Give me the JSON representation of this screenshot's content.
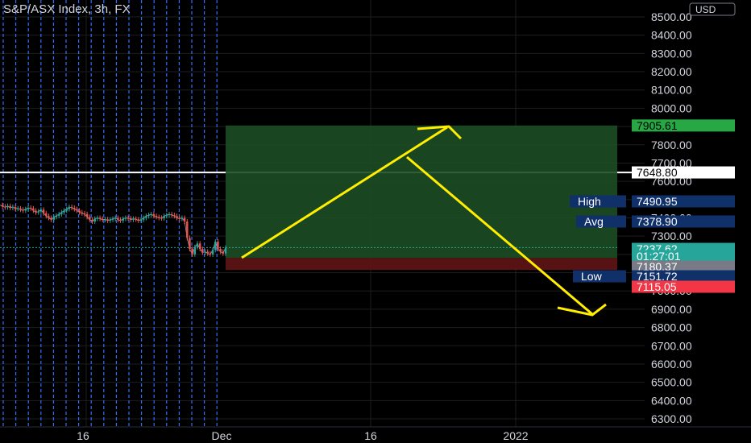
{
  "header": {
    "title": "S&P/ASX Index, 3h, FX",
    "currency": "USD"
  },
  "chart_data": {
    "type": "line",
    "title": "S&P/ASX Index, 3h, FX",
    "ylim": [
      6250,
      8530
    ],
    "y_ticks": [
      6300,
      6400,
      6500,
      6600,
      6700,
      6800,
      6900,
      7000,
      7100,
      7200,
      7300,
      7400,
      7500,
      7600,
      7700,
      7800,
      7900,
      8000,
      8100,
      8200,
      8300,
      8400,
      8500
    ],
    "y_tick_labels": [
      "6300.00",
      "6400.00",
      "6500.00",
      "6600.00",
      "6700.00",
      "6800.00",
      "6900.00",
      "7000.00",
      "7100.00",
      "7200.00",
      "7300.00",
      "7400.00",
      "7500.00",
      "7600.00",
      "7700.00",
      "7800.00",
      "7900.00",
      "8000.00",
      "8100.00",
      "8200.00",
      "8300.00",
      "8400.00",
      "8500.00"
    ],
    "x_ticks": [
      "16",
      "Dec",
      "16",
      "2022"
    ],
    "series": [
      {
        "values": [
          7470,
          7462,
          7458,
          7465,
          7455,
          7460,
          7450,
          7452,
          7445,
          7440,
          7448,
          7455,
          7452,
          7440,
          7430,
          7435,
          7445,
          7425,
          7410,
          7400,
          7390,
          7405,
          7412,
          7420,
          7430,
          7440,
          7448,
          7460,
          7455,
          7448,
          7440,
          7430,
          7425,
          7420,
          7405,
          7390,
          7380,
          7395,
          7400,
          7395,
          7390,
          7392,
          7385,
          7390,
          7395,
          7400,
          7390,
          7385,
          7395,
          7400,
          7398,
          7390,
          7395,
          7392,
          7385,
          7390,
          7400,
          7410,
          7415,
          7420,
          7410,
          7405,
          7400,
          7398,
          7410,
          7415,
          7420,
          7415,
          7410,
          7400,
          7395,
          7400,
          7380,
          7290,
          7230,
          7200,
          7240,
          7260,
          7230,
          7210,
          7215,
          7205,
          7200,
          7225,
          7270,
          7230,
          7215,
          7205,
          7237
        ]
      }
    ],
    "grid": true,
    "horizontal_line": 7648.8,
    "position_tool": {
      "target": 7905.61,
      "entry": 7180.37,
      "stop": 7115.05
    },
    "price_labels": [
      {
        "label": "7905.61",
        "value": 7905.61,
        "color": "#27a844",
        "text_color": "#000000"
      },
      {
        "label": "7648.80",
        "value": 7648.8,
        "color": "#ffffff",
        "text_color": "#000000"
      },
      {
        "label": "7237.62",
        "value": 7237.62,
        "color": "#26a69a",
        "text_color": "#ffffff"
      },
      {
        "label": "01:27:01",
        "value": 7197,
        "color": "#26a69a",
        "text_color": "#ffffff"
      },
      {
        "label": "7180.37",
        "value": 7180.37,
        "color": "#787b86",
        "text_color": "#ffffff"
      },
      {
        "label": "7151.72",
        "value": 7151.72,
        "color": "#10306a",
        "text_color": "#ffffff"
      },
      {
        "label": "7115.05",
        "value": 7115.05,
        "color": "#f23645",
        "text_color": "#ffffff"
      },
      {
        "label": "7490.95",
        "value": 7490.95,
        "color": "#10306a",
        "text_color": "#ffffff"
      },
      {
        "label": "7378.90",
        "value": 7378.9,
        "color": "#10306a",
        "text_color": "#ffffff"
      }
    ],
    "stat_labels": [
      {
        "label": "High",
        "value": 7490.95
      },
      {
        "label": "Avg",
        "value": 7378.9
      },
      {
        "label": "Low",
        "value": 7151.72
      }
    ]
  },
  "colors": {
    "background": "#000000",
    "grid": "#1e1e1e",
    "vlines": "#2f6fff",
    "arrow": "#ffee00",
    "axis_text": "#d1d4dc",
    "profit_zone": "#1c4d23",
    "loss_zone": "#5c1414",
    "candle_up": "#26a69a",
    "candle_down": "#ef5350"
  }
}
